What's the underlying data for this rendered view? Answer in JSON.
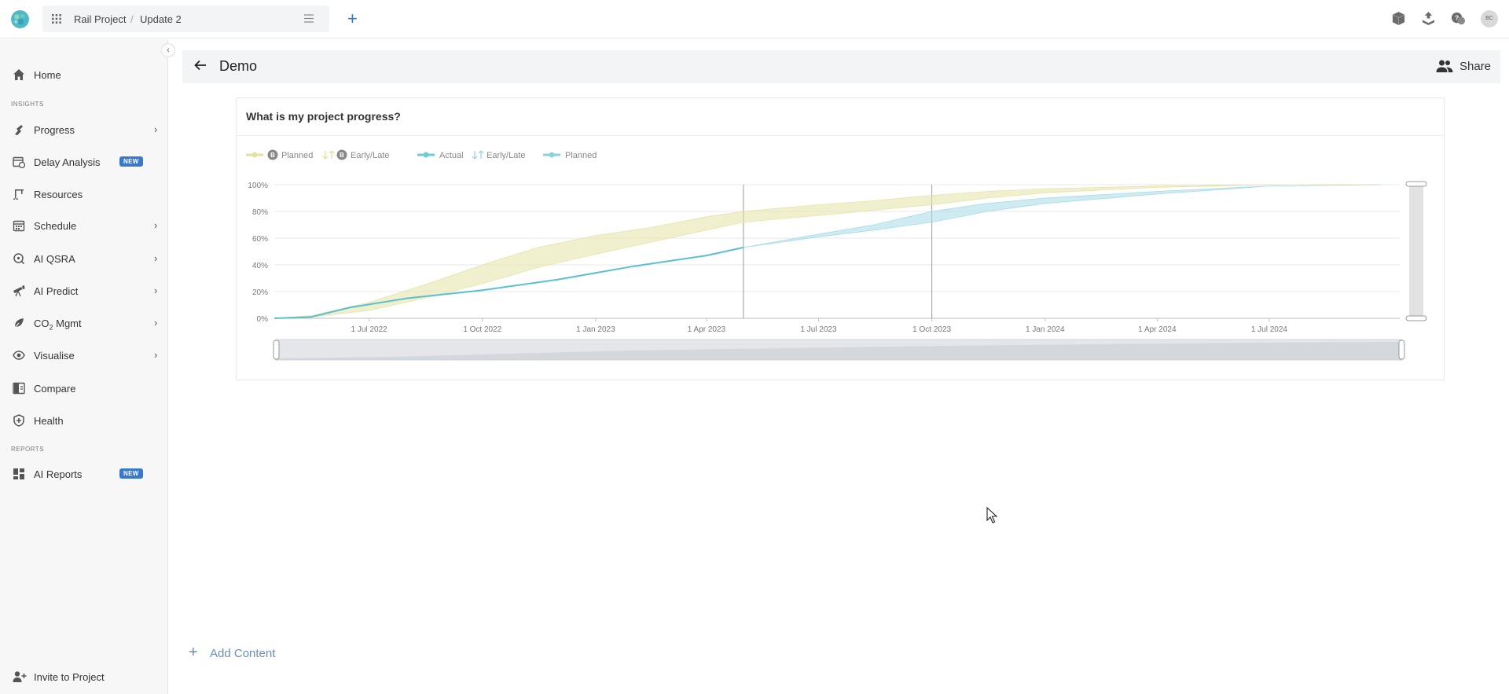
{
  "topbar": {
    "project": "Rail Project",
    "separator": "/",
    "update": "Update 2",
    "add_label": "+",
    "avatar_initials": "BC"
  },
  "sidebar": {
    "collapse_glyph": "‹",
    "home": "Home",
    "section_insights": "INSIGHTS",
    "items": [
      {
        "label": "Progress",
        "icon": "progress-icon",
        "chevron": true
      },
      {
        "label": "Delay Analysis",
        "icon": "calendar-clock-icon",
        "badge": "NEW"
      },
      {
        "label": "Resources",
        "icon": "crane-icon"
      },
      {
        "label": "Schedule",
        "icon": "schedule-icon",
        "chevron": true
      },
      {
        "label": "AI QSRA",
        "icon": "qsra-icon",
        "chevron": true
      },
      {
        "label": "AI Predict",
        "icon": "telescope-icon",
        "chevron": true
      },
      {
        "label_main": "CO",
        "label_sub": "2",
        "label_rest": " Mgmt",
        "icon": "leaf-icon",
        "chevron": true
      },
      {
        "label": "Visualise",
        "icon": "eye-icon",
        "chevron": true
      },
      {
        "label": "Compare",
        "icon": "compare-icon"
      },
      {
        "label": "Health",
        "icon": "shield-icon"
      }
    ],
    "section_reports": "REPORTS",
    "reports": [
      {
        "label": "AI Reports",
        "icon": "dashboard-icon",
        "badge": "NEW"
      }
    ],
    "invite": "Invite to Project"
  },
  "page": {
    "title": "Demo",
    "share": "Share",
    "add_content": "Add Content"
  },
  "card": {
    "title": "What is my project progress?"
  },
  "chart_data": {
    "type": "area",
    "title": "What is my project progress?",
    "legend": [
      {
        "label": "Planned",
        "badge": "B",
        "color": "#e3e0a0",
        "marker": "line-dot"
      },
      {
        "label": "Early/Late",
        "badge": "B",
        "color": "#e3e0a0",
        "marker": "arrows"
      },
      {
        "label": "Actual",
        "color": "#6dcbd6",
        "marker": "line-dot"
      },
      {
        "label": "Early/Late",
        "color": "#9ad7e8",
        "marker": "arrows"
      },
      {
        "label": "Planned",
        "color": "#8fd0df",
        "marker": "line-dot"
      }
    ],
    "x_ticks": [
      "1 Jul 2022",
      "1 Oct 2022",
      "1 Jan 2023",
      "1 Apr 2023",
      "1 Jul 2023",
      "1 Oct 2023",
      "1 Jan 2024",
      "1 Apr 2024",
      "1 Jul 2024"
    ],
    "x_range": [
      "2022-04-15",
      "2024-10-15"
    ],
    "y_ticks": [
      "0%",
      "20%",
      "40%",
      "60%",
      "80%",
      "100%"
    ],
    "ylim": [
      0,
      100
    ],
    "grid": true,
    "markers": [
      "2023-05-01",
      "2023-10-01"
    ],
    "series": [
      {
        "name": "Planned",
        "x": [
          "2022-04-15",
          "2022-05-15",
          "2022-07-01",
          "2022-08-15",
          "2022-10-01",
          "2022-11-15",
          "2023-01-01",
          "2023-02-15",
          "2023-04-01",
          "2023-05-01",
          "2023-07-01",
          "2023-08-15",
          "2023-10-01",
          "2023-11-15",
          "2024-01-01",
          "2024-04-01",
          "2024-07-01",
          "2024-09-30"
        ],
        "upper": [
          0,
          2,
          12,
          25,
          40,
          53,
          62,
          68,
          76,
          80,
          85,
          88,
          92,
          95,
          97,
          99,
          100,
          100
        ],
        "lower": [
          0,
          1,
          6,
          15,
          26,
          38,
          48,
          57,
          66,
          72,
          77,
          81,
          85,
          90,
          94,
          98,
          100,
          100
        ]
      },
      {
        "name": "Actual",
        "x": [
          "2022-04-15",
          "2022-05-15",
          "2022-06-15",
          "2022-08-01",
          "2022-10-01",
          "2022-12-01",
          "2023-02-01",
          "2023-04-01",
          "2023-05-01"
        ],
        "values": [
          0,
          1,
          8,
          15,
          21,
          29,
          39,
          47,
          53
        ]
      },
      {
        "name": "Planned",
        "x": [
          "2023-05-01",
          "2023-07-01",
          "2023-08-15",
          "2023-10-01",
          "2023-11-15",
          "2024-01-01",
          "2024-04-01",
          "2024-07-01",
          "2024-09-30"
        ],
        "upper": [
          53,
          63,
          70,
          80,
          86,
          90,
          95,
          99,
          100
        ],
        "lower": [
          53,
          61,
          66,
          72,
          80,
          86,
          93,
          99,
          100
        ]
      }
    ]
  }
}
